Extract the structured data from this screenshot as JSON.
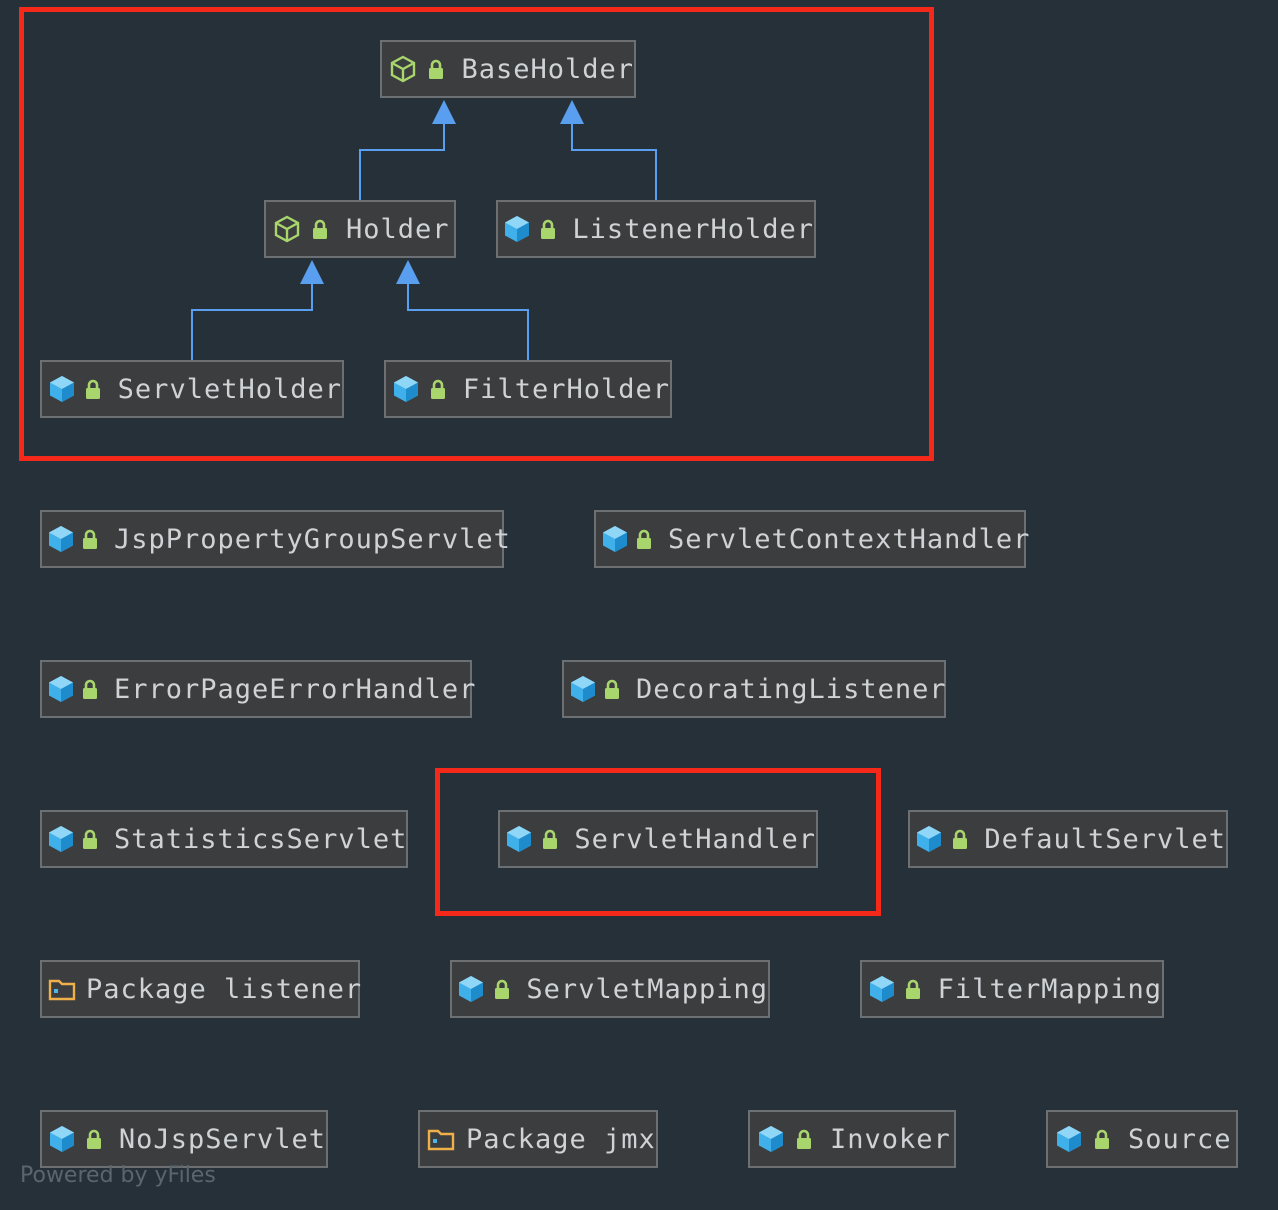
{
  "diagram": {
    "nodes": [
      {
        "id": "BaseHolder",
        "label": "BaseHolder",
        "kind": "abstract-class-icon"
      },
      {
        "id": "Holder",
        "label": "Holder",
        "kind": "abstract-class-icon"
      },
      {
        "id": "ListenerHolder",
        "label": "ListenerHolder",
        "kind": "class-icon"
      },
      {
        "id": "ServletHolder",
        "label": "ServletHolder",
        "kind": "class-icon"
      },
      {
        "id": "FilterHolder",
        "label": "FilterHolder",
        "kind": "class-icon"
      },
      {
        "id": "JspPropertyGroupServlet",
        "label": "JspPropertyGroupServlet",
        "kind": "class-icon"
      },
      {
        "id": "ServletContextHandler",
        "label": "ServletContextHandler",
        "kind": "class-icon"
      },
      {
        "id": "ErrorPageErrorHandler",
        "label": "ErrorPageErrorHandler",
        "kind": "class-icon"
      },
      {
        "id": "DecoratingListener",
        "label": "DecoratingListener",
        "kind": "class-icon"
      },
      {
        "id": "StatisticsServlet",
        "label": "StatisticsServlet",
        "kind": "class-icon"
      },
      {
        "id": "ServletHandler",
        "label": "ServletHandler",
        "kind": "class-icon"
      },
      {
        "id": "DefaultServlet",
        "label": "DefaultServlet",
        "kind": "class-icon"
      },
      {
        "id": "PackageListener",
        "label": "Package listener",
        "kind": "package-icon"
      },
      {
        "id": "ServletMapping",
        "label": "ServletMapping",
        "kind": "class-icon"
      },
      {
        "id": "FilterMapping",
        "label": "FilterMapping",
        "kind": "class-icon"
      },
      {
        "id": "NoJspServlet",
        "label": "NoJspServlet",
        "kind": "class-icon"
      },
      {
        "id": "PackageJmx",
        "label": "Package jmx",
        "kind": "package-icon"
      },
      {
        "id": "Invoker",
        "label": "Invoker",
        "kind": "class-icon"
      },
      {
        "id": "Source",
        "label": "Source",
        "kind": "class-icon"
      }
    ],
    "edges": [
      {
        "from": "Holder",
        "to": "BaseHolder",
        "type": "extends"
      },
      {
        "from": "ListenerHolder",
        "to": "BaseHolder",
        "type": "extends"
      },
      {
        "from": "ServletHolder",
        "to": "Holder",
        "type": "extends"
      },
      {
        "from": "FilterHolder",
        "to": "Holder",
        "type": "extends"
      }
    ],
    "highlight_colors": {
      "frame": "#f5281a",
      "edge": "#5a9ef0",
      "background": "#263038"
    }
  },
  "footer": {
    "text": "Powered by yFiles"
  }
}
